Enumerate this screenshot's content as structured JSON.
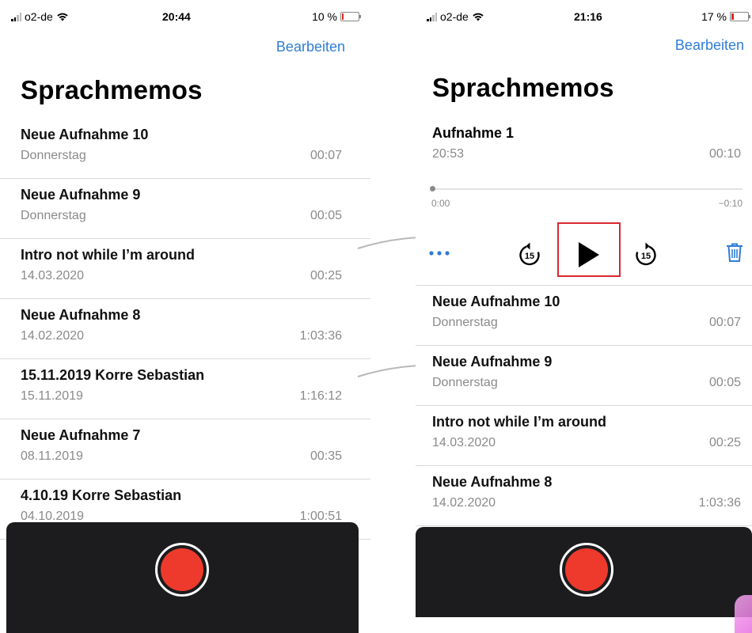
{
  "left": {
    "status": {
      "carrier": "o2-de",
      "time": "20:44",
      "battery": "10 %",
      "battery_level": 0.1
    },
    "edit_label": "Bearbeiten",
    "title": "Sprachmemos",
    "recordings": [
      {
        "name": "Neue Aufnahme 10",
        "date": "Donnerstag",
        "duration": "00:07"
      },
      {
        "name": "Neue Aufnahme 9",
        "date": "Donnerstag",
        "duration": "00:05"
      },
      {
        "name": "Intro not while I’m around",
        "date": "14.03.2020",
        "duration": "00:25"
      },
      {
        "name": "Neue Aufnahme 8",
        "date": "14.02.2020",
        "duration": "1:03:36"
      },
      {
        "name": "15.11.2019 Korre Sebastian",
        "date": "15.11.2019",
        "duration": "1:16:12"
      },
      {
        "name": "Neue Aufnahme 7",
        "date": "08.11.2019",
        "duration": "00:35"
      },
      {
        "name": "4.10.19 Korre Sebastian",
        "date": "04.10.2019",
        "duration": "1:00:51"
      }
    ]
  },
  "right": {
    "status": {
      "carrier": "o2-de",
      "time": "21:16",
      "battery": "17 %",
      "battery_level": 0.17
    },
    "edit_label": "Bearbeiten",
    "title": "Sprachmemos",
    "selected": {
      "name": "Aufnahme 1",
      "date": "20:53",
      "duration": "00:10",
      "elapsed": "0:00",
      "remaining": "−0:10",
      "progress": 0.0,
      "skip_back_label": "15",
      "skip_forward_label": "15"
    },
    "recordings": [
      {
        "name": "Neue Aufnahme 10",
        "date": "Donnerstag",
        "duration": "00:07"
      },
      {
        "name": "Neue Aufnahme 9",
        "date": "Donnerstag",
        "duration": "00:05"
      },
      {
        "name": "Intro not while I’m around",
        "date": "14.03.2020",
        "duration": "00:25"
      },
      {
        "name": "Neue Aufnahme 8",
        "date": "14.02.2020",
        "duration": "1:03:36"
      }
    ]
  },
  "colors": {
    "accent": "#2f7dd6",
    "record": "#ee3a2c",
    "panel": "#1c1c1e",
    "highlight": "#d8282f",
    "secondary_text": "#8a8a8a"
  }
}
